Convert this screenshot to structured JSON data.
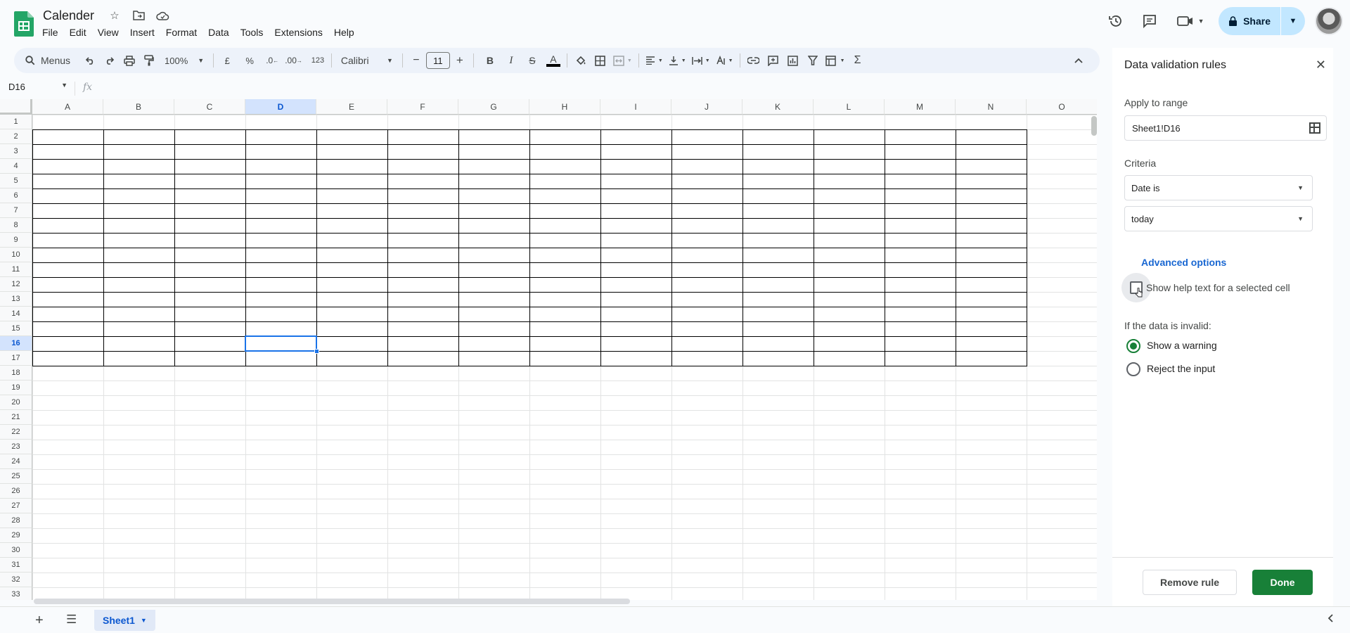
{
  "app": {
    "title": "Calender",
    "menu": [
      "File",
      "Edit",
      "View",
      "Insert",
      "Format",
      "Data",
      "Tools",
      "Extensions",
      "Help"
    ],
    "share_label": "Share"
  },
  "toolbar": {
    "search_label": "Menus",
    "zoom": "100%",
    "currency": "£",
    "percent": "%",
    "dec_decrease": ".0",
    "dec_increase": ".00",
    "number_format": "123",
    "font": "Calibri",
    "font_size": "11",
    "bold": "B",
    "italic": "I",
    "strike": "S",
    "text_color": "A",
    "sigma": "Σ"
  },
  "formula_bar": {
    "cell_ref": "D16",
    "fx": "fx"
  },
  "grid": {
    "columns": [
      "A",
      "B",
      "C",
      "D",
      "E",
      "F",
      "G",
      "H",
      "I",
      "J",
      "K",
      "L",
      "M",
      "N",
      "O"
    ],
    "rows": [
      "1",
      "2",
      "3",
      "4",
      "5",
      "6",
      "7",
      "8",
      "9",
      "10",
      "11",
      "12",
      "13",
      "14",
      "15",
      "16",
      "17",
      "18",
      "19",
      "20",
      "21",
      "22",
      "23",
      "24",
      "25",
      "26",
      "27",
      "28",
      "29",
      "30",
      "31",
      "32",
      "33"
    ],
    "selected_cell": "D16"
  },
  "sheet_tabs": {
    "active": "Sheet1"
  },
  "panel": {
    "title": "Data validation rules",
    "apply_label": "Apply to range",
    "range_value": "Sheet1!D16",
    "criteria_label": "Criteria",
    "criteria_value": "Date is",
    "criteria_sub_value": "today",
    "advanced_label": "Advanced options",
    "help_text_label": "Show help text for a selected cell",
    "help_text_checked": false,
    "invalid_label": "If the data is invalid:",
    "options": [
      {
        "label": "Show a warning",
        "selected": true
      },
      {
        "label": "Reject the input",
        "selected": false
      }
    ],
    "remove_label": "Remove rule",
    "done_label": "Done",
    "accent_color": "#188038"
  }
}
